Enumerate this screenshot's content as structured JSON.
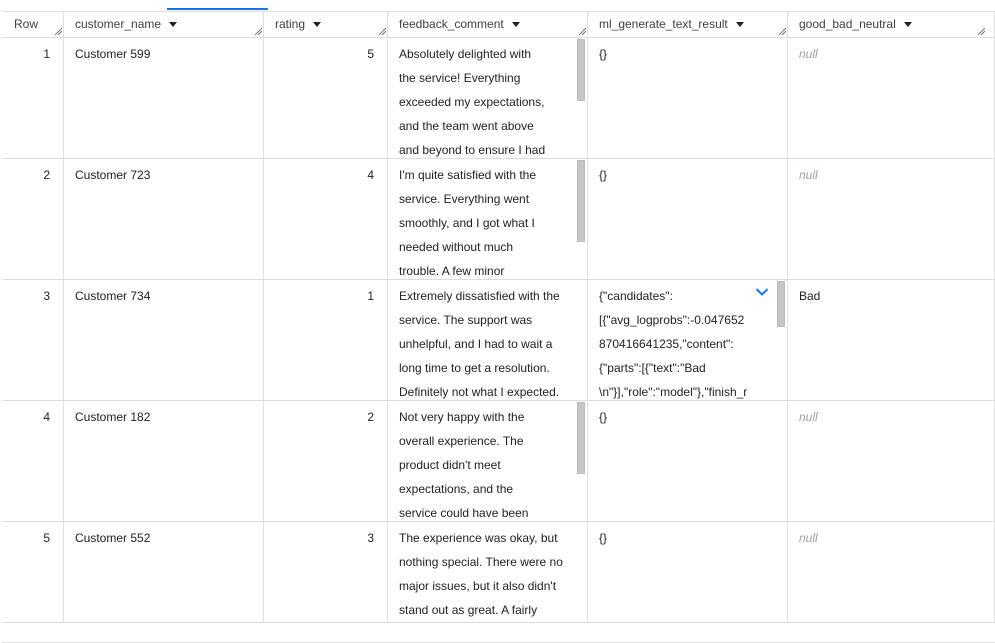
{
  "columns": {
    "row": "Row",
    "customer_name": "customer_name",
    "rating": "rating",
    "feedback_comment": "feedback_comment",
    "ml_generate_text_result": "ml_generate_text_result",
    "good_bad_neutral": "good_bad_neutral"
  },
  "rows": [
    {
      "row": "1",
      "customer_name": "Customer 599",
      "rating": "5",
      "feedback_lines": [
        "Absolutely delighted with",
        "the service! Everything",
        "exceeded my expectations,",
        "and the team went above",
        "and beyond to ensure I had"
      ],
      "ml_lines": [
        "{}"
      ],
      "good_bad_neutral": "null"
    },
    {
      "row": "2",
      "customer_name": "Customer 723",
      "rating": "4",
      "feedback_lines": [
        "I'm quite satisfied with the",
        "service. Everything went",
        "smoothly, and I got what I",
        "needed without much",
        "trouble. A few minor"
      ],
      "ml_lines": [
        "{}"
      ],
      "good_bad_neutral": "null"
    },
    {
      "row": "3",
      "customer_name": "Customer 734",
      "rating": "1",
      "feedback_lines": [
        "Extremely dissatisfied with the",
        "service. The support was",
        "unhelpful, and I had to wait a",
        "long time to get a resolution.",
        "Definitely not what I expected."
      ],
      "ml_lines": [
        "{\"candidates\":",
        "[{\"avg_logprobs\":-0.047652",
        "870416641235,\"content\":",
        "{\"parts\":[{\"text\":\"Bad",
        "\\n\"}],\"role\":\"model\"},\"finish_r"
      ],
      "good_bad_neutral": "Bad"
    },
    {
      "row": "4",
      "customer_name": "Customer 182",
      "rating": "2",
      "feedback_lines": [
        "Not very happy with the",
        "overall experience. The",
        "product didn't meet",
        "expectations, and the",
        "service could have been"
      ],
      "ml_lines": [
        "{}"
      ],
      "good_bad_neutral": "null"
    },
    {
      "row": "5",
      "customer_name": "Customer 552",
      "rating": "3",
      "feedback_lines": [
        "The experience was okay, but",
        "nothing special. There were no",
        "major issues, but it also didn't",
        "stand out as great. A fairly"
      ],
      "ml_lines": [
        "{}"
      ],
      "good_bad_neutral": "null"
    }
  ],
  "icons": {
    "sort": "caret-down-icon",
    "resize": "column-resize-icon",
    "expand": "chevron-down-icon"
  },
  "colors": {
    "accent": "#1a73e8",
    "null_text": "#9aa0a6",
    "border": "#dadce0"
  }
}
